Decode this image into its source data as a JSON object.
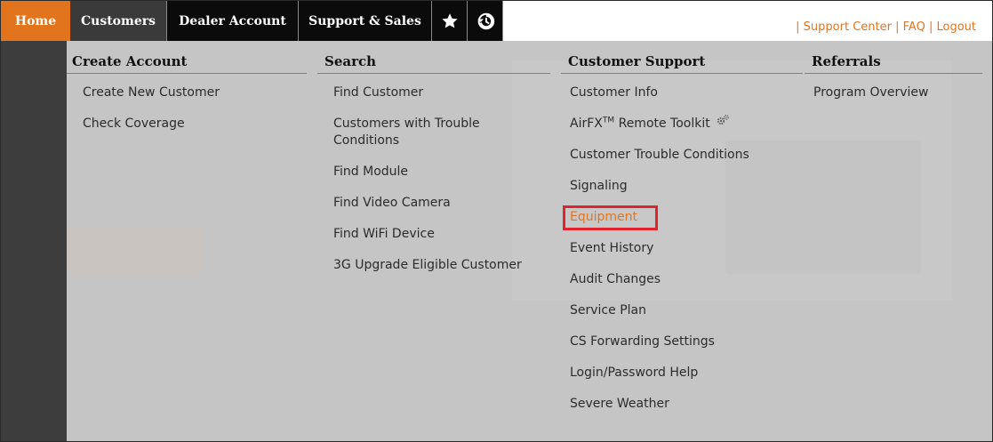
{
  "nav": {
    "home": "Home",
    "customers": "Customers",
    "dealer_account": "Dealer Account",
    "support_sales": "Support & Sales",
    "star_icon": "star-icon",
    "history_icon": "history-icon"
  },
  "top_links": {
    "sep": "|",
    "support_center": "Support Center",
    "faq": "FAQ",
    "logout": "Logout"
  },
  "menu": {
    "create_account": {
      "header": "Create Account",
      "items": [
        "Create New Customer",
        "Check Coverage"
      ]
    },
    "search": {
      "header": "Search",
      "items": [
        "Find Customer",
        "Customers with Trouble Conditions",
        "Find Module",
        "Find Video Camera",
        "Find WiFi Device",
        "3G Upgrade Eligible Customer"
      ]
    },
    "customer_support": {
      "header": "Customer Support",
      "customer_info": "Customer Info",
      "airfx_pre": "AirFX",
      "airfx_sup": "TM",
      "airfx_post": " Remote Toolkit",
      "items": [
        "Customer Trouble Conditions",
        "Signaling",
        "Equipment",
        "Event History",
        "Audit Changes",
        "Service Plan",
        "CS Forwarding Settings",
        "Login/Password Help",
        "Severe Weather"
      ]
    },
    "referrals": {
      "header": "Referrals",
      "items": [
        "Program Overview"
      ]
    }
  },
  "colors": {
    "brand_orange": "#e2741d",
    "highlight_red": "#e1232b",
    "nav_black": "#0b0b0b"
  }
}
